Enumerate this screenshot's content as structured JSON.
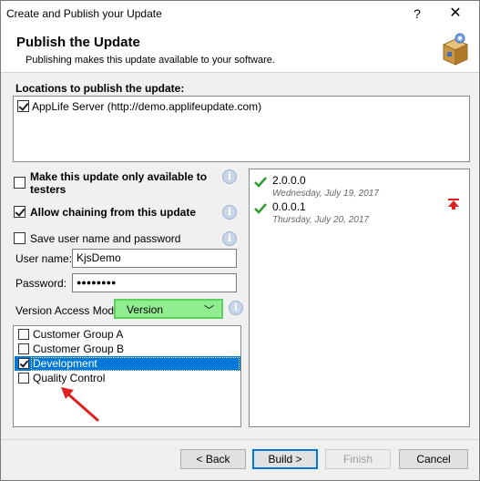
{
  "window": {
    "title": "Create and Publish your Update",
    "help_glyph": "?",
    "close_glyph": "✕"
  },
  "header": {
    "title": "Publish the Update",
    "subtitle": "Publishing makes this update available to your software.",
    "icon": "package-icon"
  },
  "locations": {
    "label": "Locations to publish the update:",
    "items": [
      {
        "label": "AppLife Server (http://demo.applifeupdate.com)",
        "checked": true
      }
    ]
  },
  "options": {
    "testers": {
      "label_line1": "Make this update only available to",
      "label_line2": "testers",
      "checked": false
    },
    "chaining": {
      "label": "Allow chaining from this update",
      "checked": true
    },
    "save_credentials": {
      "label": "Save user name and password",
      "checked": false
    }
  },
  "credentials": {
    "username_label": "User name:",
    "username_value": "KjsDemo",
    "password_label": "Password:",
    "password_value": "●●●●●●●●"
  },
  "version_access": {
    "label": "Version Access Mode:",
    "selected": "Version",
    "highlight_color": "#90ee90"
  },
  "groups": [
    {
      "label": "Customer Group A",
      "checked": false,
      "selected": false
    },
    {
      "label": "Customer Group B",
      "checked": false,
      "selected": false
    },
    {
      "label": "Development",
      "checked": true,
      "selected": true
    },
    {
      "label": "Quality Control",
      "checked": false,
      "selected": false
    }
  ],
  "versions": [
    {
      "version": "2.0.0.0",
      "date": "Wednesday, July 19, 2017"
    },
    {
      "version": "0.0.0.1",
      "date": "Thursday, July 20, 2017"
    }
  ],
  "buttons": {
    "back": "< Back",
    "build": "Build >",
    "finish": "Finish",
    "cancel": "Cancel"
  },
  "colors": {
    "selection": "#0078d7",
    "annotation_arrow": "#e02020",
    "check_green": "#2e9e2e"
  }
}
